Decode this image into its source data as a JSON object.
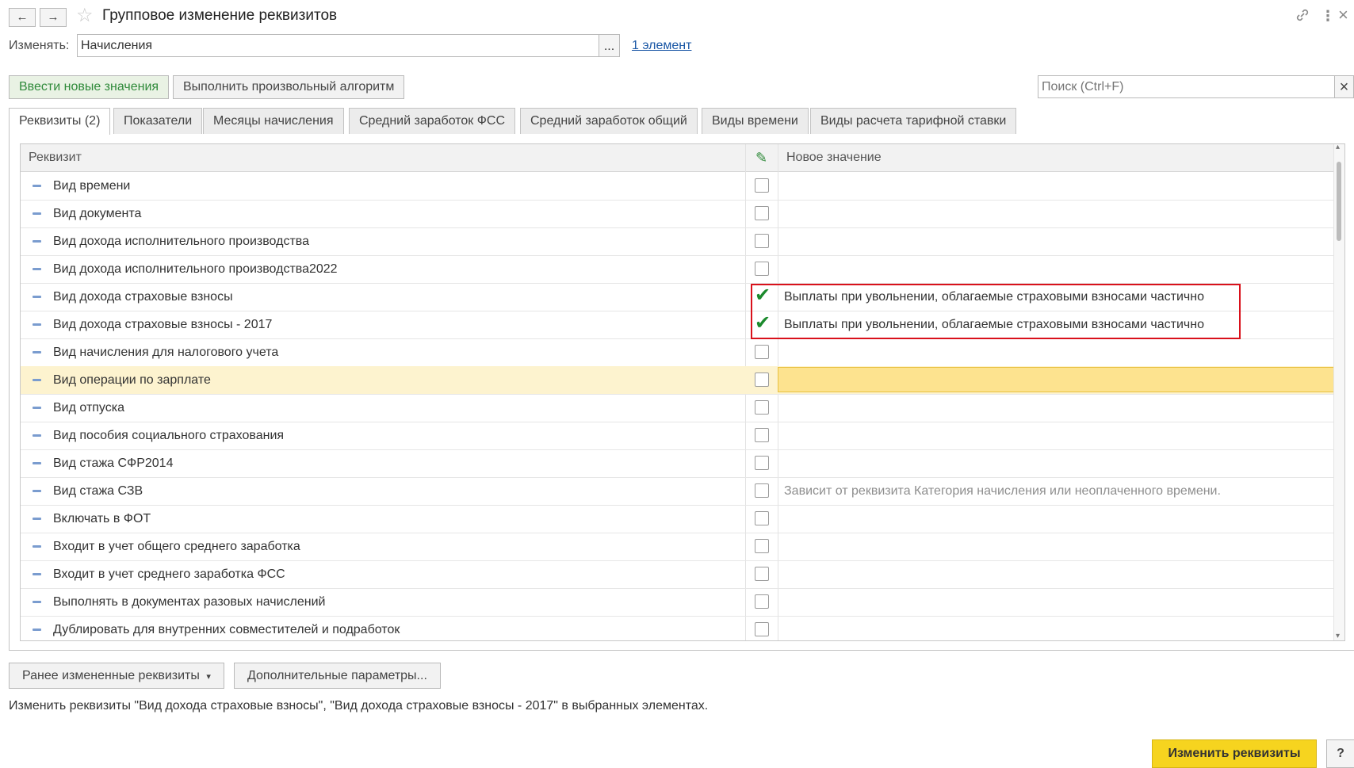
{
  "window": {
    "title": "Групповое изменение реквизитов",
    "back_icon": "←",
    "forward_icon": "→",
    "star_icon": "☆",
    "link_icon": "🔗",
    "menu_icon": "⋮",
    "close_icon": "×"
  },
  "edit_row": {
    "label": "Изменять:",
    "value": "Начисления",
    "select_btn": "...",
    "elements_link": "1 элемент"
  },
  "commands": {
    "new_values": "Ввести новые значения",
    "algorithm": "Выполнить произвольный алгоритм",
    "search_placeholder": "Поиск (Ctrl+F)",
    "search_clear": "×"
  },
  "tabs": [
    {
      "label": "Реквизиты (2)"
    },
    {
      "label": "Показатели"
    },
    {
      "label": "Месяцы начисления"
    },
    {
      "label": "Средний заработок ФСС"
    },
    {
      "label": "Средний заработок общий"
    },
    {
      "label": "Виды времени"
    },
    {
      "label": "Виды расчета тарифной ставки"
    }
  ],
  "table": {
    "col_attr": "Реквизит",
    "col_edit_icon": "✎",
    "col_new": "Новое значение",
    "rows": [
      {
        "name": "Вид времени",
        "checked": false,
        "value": ""
      },
      {
        "name": "Вид документа",
        "checked": false,
        "value": ""
      },
      {
        "name": "Вид дохода исполнительного производства",
        "checked": false,
        "value": ""
      },
      {
        "name": "Вид дохода исполнительного производства2022",
        "checked": false,
        "value": ""
      },
      {
        "name": "Вид дохода страховые взносы",
        "checked": true,
        "value": "Выплаты при увольнении, облагаемые страховыми взносами частично"
      },
      {
        "name": "Вид дохода страховые взносы - 2017",
        "checked": true,
        "value": "Выплаты при увольнении, облагаемые страховыми взносами частично"
      },
      {
        "name": "Вид начисления для налогового учета",
        "checked": false,
        "value": ""
      },
      {
        "name": "Вид операции по зарплате",
        "checked": false,
        "value": "",
        "selected": true
      },
      {
        "name": "Вид отпуска",
        "checked": false,
        "value": ""
      },
      {
        "name": "Вид пособия социального страхования",
        "checked": false,
        "value": ""
      },
      {
        "name": "Вид стажа  СФР2014",
        "checked": false,
        "value": ""
      },
      {
        "name": "Вид стажа СЗВ",
        "checked": false,
        "value": "Зависит от реквизита Категория начисления или неоплаченного времени.",
        "gray": true
      },
      {
        "name": "Включать в ФОТ",
        "checked": false,
        "value": ""
      },
      {
        "name": "Входит в учет общего среднего заработка",
        "checked": false,
        "value": ""
      },
      {
        "name": "Входит в учет среднего заработка ФСС",
        "checked": false,
        "value": ""
      },
      {
        "name": "Выполнять в документах разовых начислений",
        "checked": false,
        "value": ""
      },
      {
        "name": "Дублировать для внутренних совместителей и подработок",
        "checked": false,
        "value": ""
      }
    ],
    "check_glyph": "✔",
    "scroll_up": "▴",
    "scroll_down": "▾"
  },
  "bottom": {
    "prev_changed": "Ранее измененные реквизиты",
    "prev_changed_arrow": "▾",
    "extra_params": "Дополнительные параметры...",
    "status": "Изменить реквизиты \"Вид дохода страховые взносы\", \"Вид дохода страховые взносы - 2017\" в выбранных элементах.",
    "apply": "Изменить реквизиты",
    "help": "?"
  },
  "colors": {
    "accent_yellow": "#f6d41f",
    "selected_row": "#fdf3cf",
    "check_green": "#1b8a2c",
    "highlight_red": "#d9111b",
    "link_blue": "#1a57a5"
  }
}
